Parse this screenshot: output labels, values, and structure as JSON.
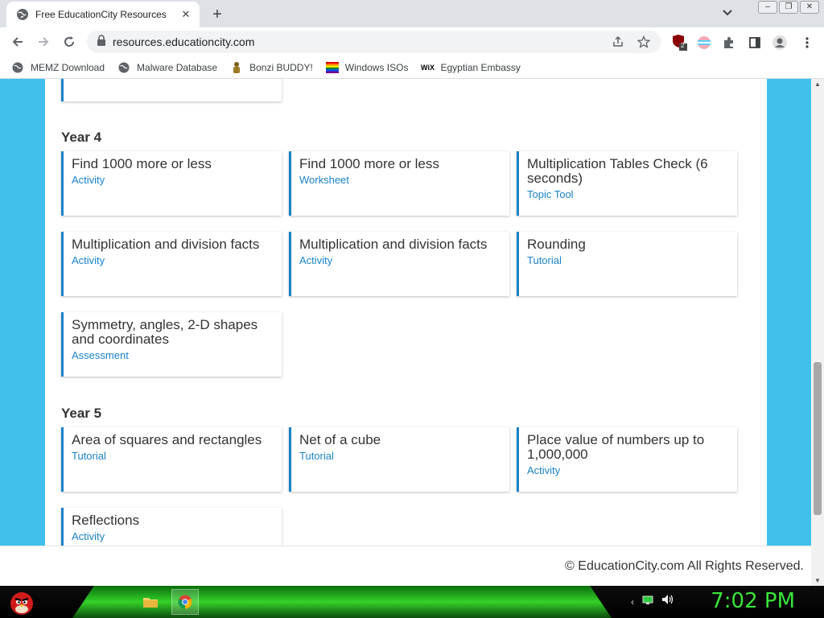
{
  "browser": {
    "tab_title": "Free EducationCity Resources",
    "tab_close": "✕",
    "new_tab": "+",
    "url": "resources.educationcity.com",
    "extension_badge": "2"
  },
  "bookmarks": [
    {
      "label": "MEMZ Download",
      "icon": "globe-icon"
    },
    {
      "label": "Malware Database",
      "icon": "globe-icon"
    },
    {
      "label": "Bonzi BUDDY!",
      "icon": "bonzi-icon"
    },
    {
      "label": "Windows ISOs",
      "icon": "windows-flag-icon"
    },
    {
      "label": "Egyptian Embassy",
      "icon": "wix-icon"
    }
  ],
  "page": {
    "year4_title": "Year 4",
    "year5_title": "Year 5",
    "year4_cards": [
      {
        "title": "Find 1000 more or less",
        "type": "Activity"
      },
      {
        "title": "Find 1000 more or less",
        "type": "Worksheet"
      },
      {
        "title": "Multiplication Tables Check (6 seconds)",
        "type": "Topic Tool"
      },
      {
        "title": "Multiplication and division facts",
        "type": "Activity"
      },
      {
        "title": "Multiplication and division facts",
        "type": "Activity"
      },
      {
        "title": "Rounding",
        "type": "Tutorial"
      },
      {
        "title": "Symmetry, angles, 2-D shapes and coordinates",
        "type": "Assessment"
      }
    ],
    "year5_cards": [
      {
        "title": "Area of squares and rectangles",
        "type": "Tutorial"
      },
      {
        "title": "Net of a cube",
        "type": "Tutorial"
      },
      {
        "title": "Place value of numbers up to 1,000,000",
        "type": "Activity"
      },
      {
        "title": "Reflections",
        "type": "Activity"
      }
    ],
    "footer": "© EducationCity.com All Rights Reserved."
  },
  "taskbar": {
    "clock": "7:02 PM"
  },
  "colors": {
    "page_background": "#3fc1eb",
    "card_accent": "#1a82c8",
    "clock": "#39e639"
  }
}
